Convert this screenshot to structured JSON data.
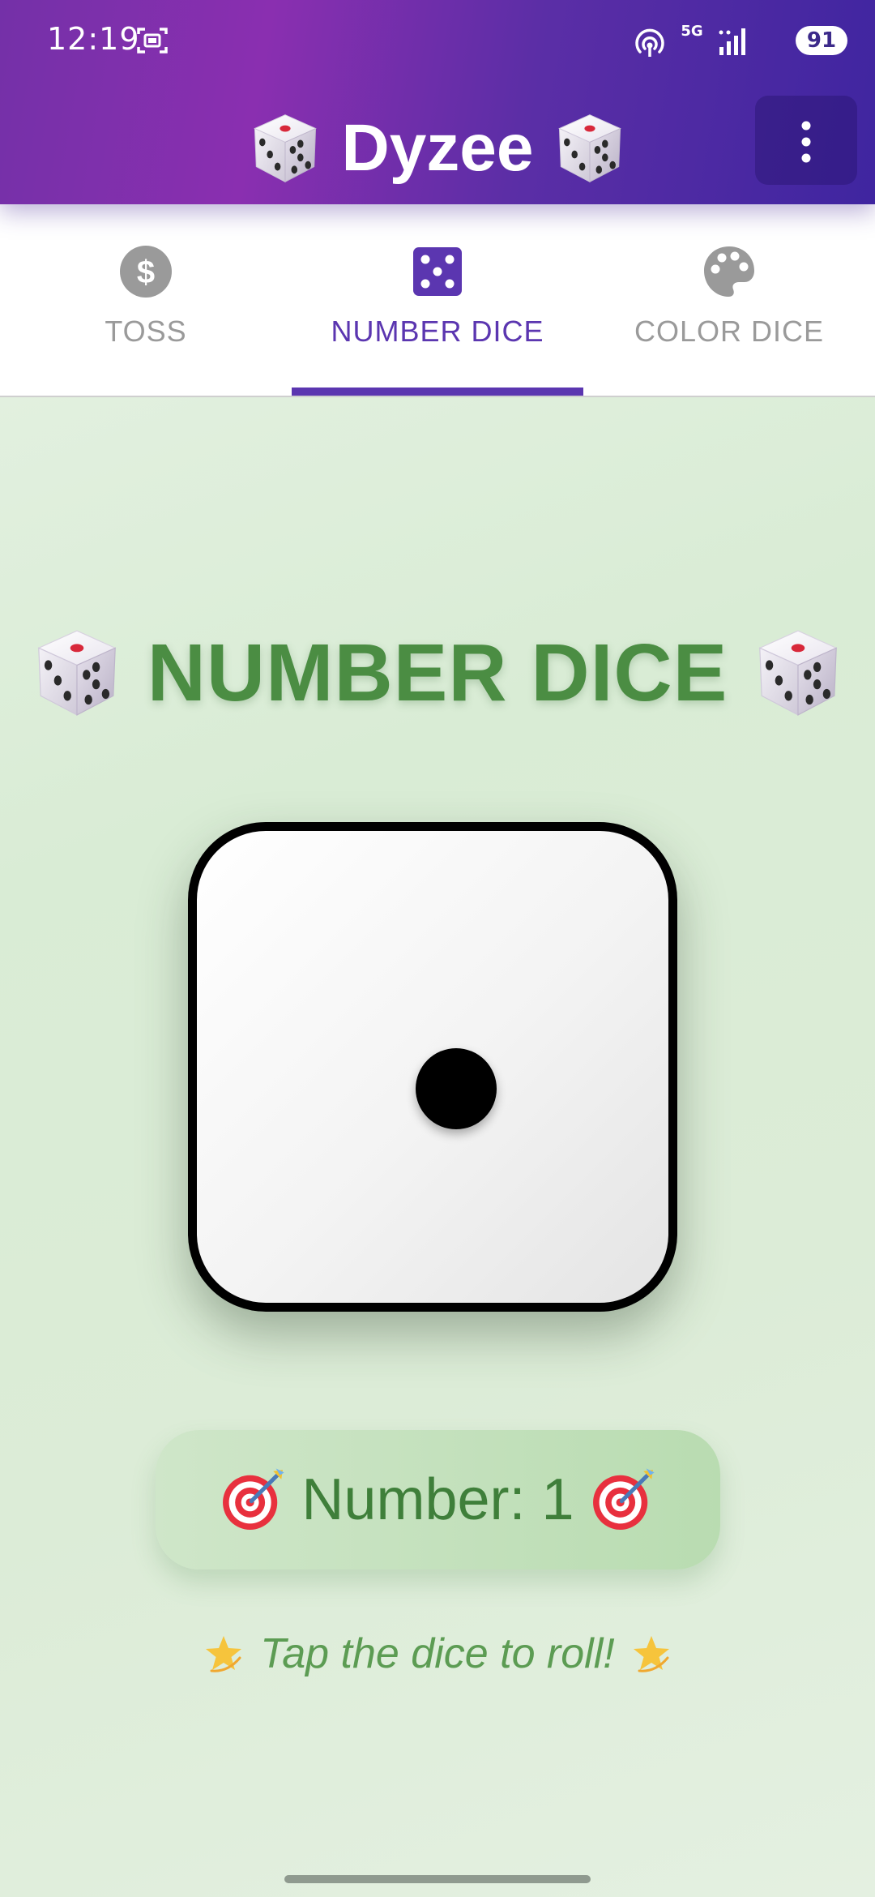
{
  "status_bar": {
    "time": "12:19",
    "network": "5G",
    "battery": "91"
  },
  "header": {
    "app_title": "Dyzee"
  },
  "tabs": [
    {
      "label": "TOSS",
      "icon": "dollar-coin-icon",
      "active": false
    },
    {
      "label": "NUMBER DICE",
      "icon": "dice-five-icon",
      "active": true
    },
    {
      "label": "COLOR DICE",
      "icon": "palette-icon",
      "active": false
    }
  ],
  "main": {
    "section_title": "NUMBER DICE",
    "dice_value": 1,
    "result_text": "Number: 1",
    "hint": "Tap the dice to roll!"
  },
  "colors": {
    "header_gradient": [
      "#7430a8",
      "#3f25a0"
    ],
    "accent": "#5b36b0",
    "title_green": "#4b8d43",
    "result_green": "#3f7f3a",
    "hint_green": "#5c9c53",
    "inactive_tab": "#9a9a9a"
  }
}
